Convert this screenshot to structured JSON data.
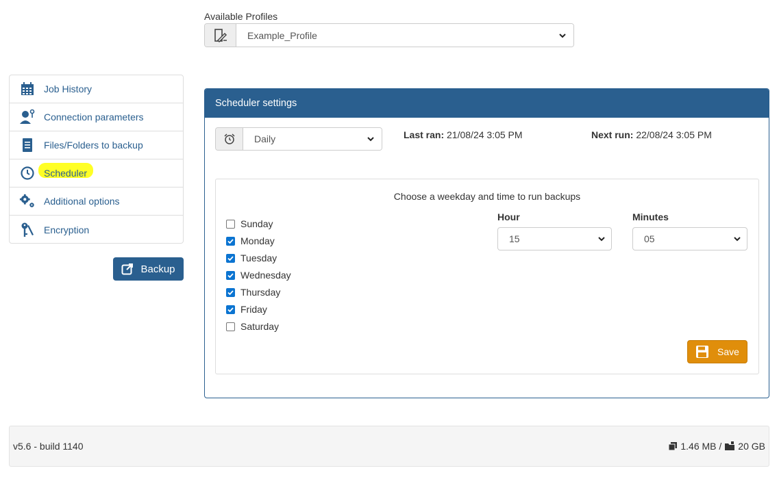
{
  "profiles": {
    "label": "Available Profiles",
    "selected": "Example_Profile",
    "icon": "profile-edit-icon"
  },
  "sidebar": {
    "items": [
      {
        "label": "Job History",
        "icon": "calendar-icon"
      },
      {
        "label": "Connection parameters",
        "icon": "user-key-icon"
      },
      {
        "label": "Files/Folders to backup",
        "icon": "document-icon"
      },
      {
        "label": "Scheduler",
        "icon": "clock-icon"
      },
      {
        "label": "Additional options",
        "icon": "gears-icon"
      },
      {
        "label": "Encryption",
        "icon": "keys-icon"
      }
    ],
    "backup_label": "Backup"
  },
  "scheduler": {
    "title": "Scheduler settings",
    "frequency": "Daily",
    "last_ran_label": "Last ran:",
    "last_ran_value": "21/08/24 3:05 PM",
    "next_run_label": "Next run:",
    "next_run_value": "22/08/24 3:05 PM",
    "instructions": "Choose a weekday and time to run backups",
    "days": [
      {
        "label": "Sunday",
        "checked": false
      },
      {
        "label": "Monday",
        "checked": true
      },
      {
        "label": "Tuesday",
        "checked": true
      },
      {
        "label": "Wednesday",
        "checked": true
      },
      {
        "label": "Thursday",
        "checked": true
      },
      {
        "label": "Friday",
        "checked": true
      },
      {
        "label": "Saturday",
        "checked": false
      }
    ],
    "hour_label": "Hour",
    "hour_value": "15",
    "minutes_label": "Minutes",
    "minutes_value": "05",
    "save_label": "Save"
  },
  "footer": {
    "version": "v5.6 - build 1140",
    "size_used": "1.46 MB /",
    "size_total": "20 GB"
  },
  "colors": {
    "primary": "#2a5f8f",
    "save": "#e08e0b",
    "highlight": "#ffff1a",
    "checkbox": "#0b74d1"
  }
}
